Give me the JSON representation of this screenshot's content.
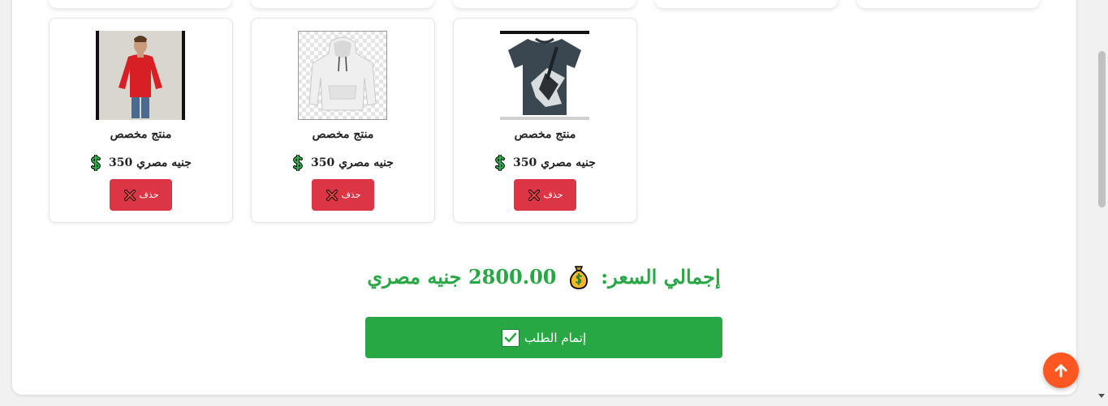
{
  "products": [
    {
      "name": "منتج مخصص",
      "price": "جنيه مصري 350",
      "delete_label": "حذف",
      "image": "red-sweater-photo"
    },
    {
      "name": "منتج مخصص",
      "price": "جنيه مصري 350",
      "delete_label": "حذف",
      "image": "white-hoodie-photo"
    },
    {
      "name": "منتج مخصص",
      "price": "جنيه مصري 350",
      "delete_label": "حذف",
      "image": "dark-tshirt-photo"
    }
  ],
  "summary": {
    "total_label": "إجمالي السعر:",
    "total_amount": "2800.00 جنيه مصري"
  },
  "checkout": {
    "label": "إتمام الطلب"
  },
  "icons": {
    "price": "dollar-sign-icon",
    "delete": "x-icon",
    "total": "money-bag-icon",
    "checkout": "check-icon",
    "scroll_top": "arrow-up-icon"
  },
  "colors": {
    "danger": "#dc3545",
    "success": "#28a745",
    "accent": "#ff5722"
  }
}
